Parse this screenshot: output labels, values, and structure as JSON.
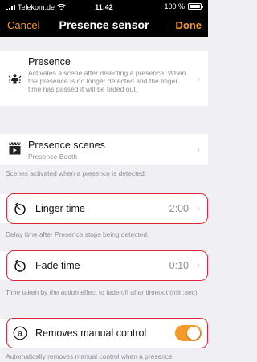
{
  "status_bar": {
    "carrier": "Telekom.de",
    "time": "11:42",
    "battery": "100 %"
  },
  "nav": {
    "cancel_label": "Cancel",
    "title": "Presence sensor",
    "done_label": "Done"
  },
  "presence": {
    "title": "Presence",
    "description": "Activates a scene after detecting a presence. When the presence is no longer detected and the linger time has passed it will be faded out.",
    "icon": "presence-person-icon"
  },
  "presence_scenes": {
    "title": "Presence scenes",
    "subtitle": "Presence Booth",
    "footer": "Scenes activated when a presence is detected.",
    "icon": "scene-clapperboard-icon"
  },
  "linger_time": {
    "label": "Linger time",
    "value": "2:00",
    "footer": "Delay time after Presence stops being detected."
  },
  "fade_time": {
    "label": "Fade time",
    "value": "0:10",
    "footer": "Time taken by the action effect to fade off after timeout (min:sec)"
  },
  "removes_manual": {
    "label": "Removes manual control",
    "toggle_on": true,
    "footer": "Automatically removes manual control when a presence"
  },
  "colors": {
    "accent": "#f39a2a",
    "highlight_border": "#e0253a"
  }
}
